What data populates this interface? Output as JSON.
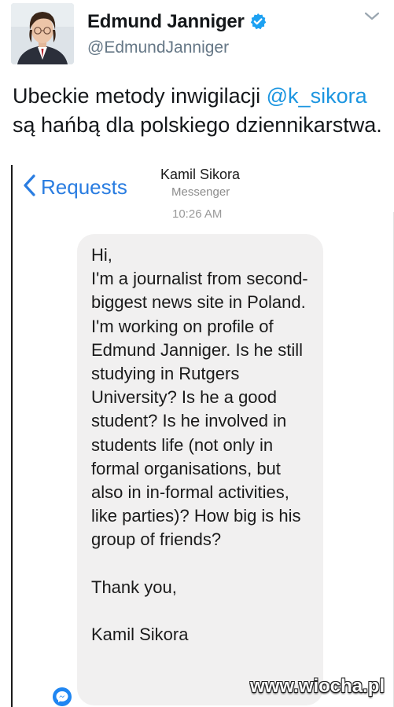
{
  "tweet": {
    "author_name": "Edmund Janniger",
    "handle": "@EdmundJanniger",
    "text_before": "Ubeckie metody inwigilacji ",
    "mention": "@k_sikora",
    "text_after": " są hańbą dla polskiego dziennikarstwa."
  },
  "messenger": {
    "back_label": "Requests",
    "contact_name": "Kamil Sikora",
    "contact_subtitle": "Messenger",
    "timestamp": "10:26 AM",
    "message": "Hi,\nI'm a journalist from second-biggest news site in Poland. I'm working on profile of Edmund Janniger. Is he still studying in Rutgers University? Is he a good student? Is he involved in students life (not only in formal organisations, but also in in-formal activities, like parties)? How big is his group of friends?\n\nThank you,\n\nKamil Sikora"
  },
  "watermark": "www.wiocha.pl",
  "colors": {
    "mention": "#1b95e0",
    "ios_blue": "#2a7de1",
    "bubble": "#f1f0f0",
    "verified": "#1da1f2"
  }
}
